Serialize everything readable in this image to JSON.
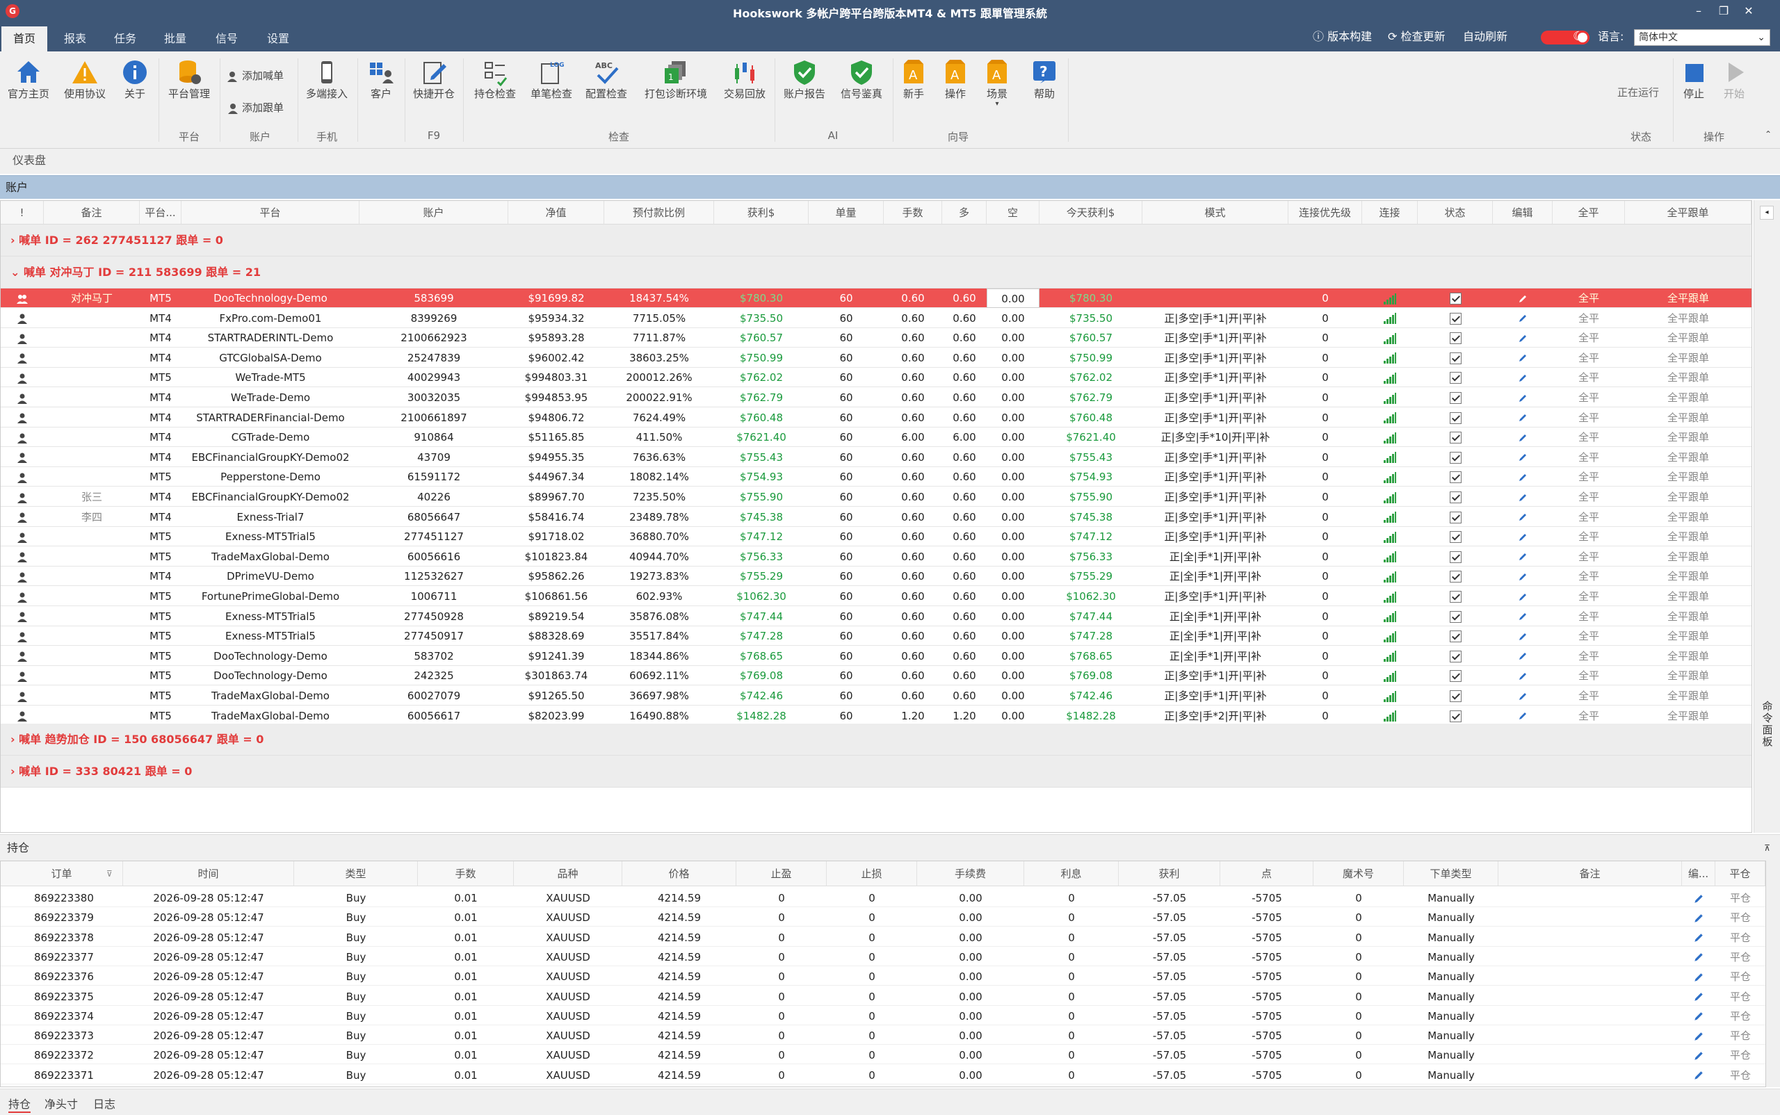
{
  "app": {
    "title": "Hookswork 多帐户跨平台跨版本MT4 & MT5 跟單管理系統",
    "logo": "G"
  },
  "menu": {
    "tabs": [
      "首页",
      "报表",
      "任务",
      "批量",
      "信号",
      "设置"
    ],
    "active": 0,
    "right": {
      "version": "版本构建",
      "update": "检查更新",
      "autorefresh": "自动刷新",
      "lang_label": "语言:",
      "lang_value": "简体中文"
    }
  },
  "ribbon": {
    "buttons": {
      "home": "官方主页",
      "agreement": "使用协议",
      "about": "关于",
      "platform_mgmt": "平台管理",
      "add_master": "添加喊单",
      "add_follower": "添加跟单",
      "mobile": "多端接入",
      "customer": "客户",
      "quick_open": "快捷开仓",
      "pos_check": "持仓检查",
      "order_check": "单笔检查",
      "config_check": "配置检查",
      "pack_diag": "打包诊断环境",
      "trade_replay": "交易回放",
      "account_report": "账户报告",
      "signal_eval": "信号鉴真",
      "novice": "新手",
      "operation": "操作",
      "scene": "场景",
      "help": "帮助",
      "stop": "停止",
      "start": "开始"
    },
    "groups": {
      "platform": "平台",
      "account": "账户",
      "mobile": "手机",
      "f9": "F9",
      "check": "检查",
      "ai": "AI",
      "guide": "向导",
      "status": "状态",
      "operate": "操作"
    },
    "status_text": "正在运行"
  },
  "dashboard_label": "仪表盘",
  "accounts_label": "账户",
  "columns": [
    "!",
    "备注",
    "平台...",
    "平台",
    "账户",
    "净值",
    "预付款比例",
    "获利$",
    "单量",
    "手数",
    "多",
    "空",
    "今天获利$",
    "模式",
    "连接优先级",
    "连接",
    "状态",
    "编辑",
    "全平",
    "全平跟单"
  ],
  "groups": {
    "g1": "›  喊单  ID = 262 277451127  跟单 = 0",
    "g2": "⌄  喊单  对冲马丁 ID = 211 583699  跟单 = 21",
    "g3": "›  喊单  趋势加仓 ID = 150 68056647  跟单 = 0",
    "g4": "›  喊单  ID = 333 80421  跟单 = 0"
  },
  "rows": [
    {
      "note": "对冲马丁",
      "pt": "MT5",
      "platform": "DooTechnology-Demo",
      "account": "583699",
      "equity": "$91699.82",
      "margin": "18437.54%",
      "profit": "$780.30",
      "orders": "60",
      "lots": "0.60",
      "long": "0.60",
      "short": "0.00",
      "today": "$780.30",
      "mode": "",
      "prio": "0",
      "full": "全平",
      "fullf": "全平跟单"
    },
    {
      "note": "",
      "pt": "MT4",
      "platform": "FxPro.com-Demo01",
      "account": "8399269",
      "equity": "$95934.32",
      "margin": "7715.05%",
      "profit": "$735.50",
      "orders": "60",
      "lots": "0.60",
      "long": "0.60",
      "short": "0.00",
      "today": "$735.50",
      "mode": "正|多空|手*1|开|平|补",
      "prio": "0",
      "full": "全平",
      "fullf": "全平跟单"
    },
    {
      "note": "",
      "pt": "MT4",
      "platform": "STARTRADERINTL-Demo",
      "account": "2100662923",
      "equity": "$95893.28",
      "margin": "7711.87%",
      "profit": "$760.57",
      "orders": "60",
      "lots": "0.60",
      "long": "0.60",
      "short": "0.00",
      "today": "$760.57",
      "mode": "正|多空|手*1|开|平|补",
      "prio": "0",
      "full": "全平",
      "fullf": "全平跟单"
    },
    {
      "note": "",
      "pt": "MT4",
      "platform": "GTCGlobalSA-Demo",
      "account": "25247839",
      "equity": "$96002.42",
      "margin": "38603.25%",
      "profit": "$750.99",
      "orders": "60",
      "lots": "0.60",
      "long": "0.60",
      "short": "0.00",
      "today": "$750.99",
      "mode": "正|多空|手*1|开|平|补",
      "prio": "0",
      "full": "全平",
      "fullf": "全平跟单"
    },
    {
      "note": "",
      "pt": "MT5",
      "platform": "WeTrade-MT5",
      "account": "40029943",
      "equity": "$994803.31",
      "margin": "200012.26%",
      "profit": "$762.02",
      "orders": "60",
      "lots": "0.60",
      "long": "0.60",
      "short": "0.00",
      "today": "$762.02",
      "mode": "正|多空|手*1|开|平|补",
      "prio": "0",
      "full": "全平",
      "fullf": "全平跟单"
    },
    {
      "note": "",
      "pt": "MT4",
      "platform": "WeTrade-Demo",
      "account": "30032035",
      "equity": "$994853.95",
      "margin": "200022.91%",
      "profit": "$762.79",
      "orders": "60",
      "lots": "0.60",
      "long": "0.60",
      "short": "0.00",
      "today": "$762.79",
      "mode": "正|多空|手*1|开|平|补",
      "prio": "0",
      "full": "全平",
      "fullf": "全平跟单"
    },
    {
      "note": "",
      "pt": "MT4",
      "platform": "STARTRADERFinancial-Demo",
      "account": "2100661897",
      "equity": "$94806.72",
      "margin": "7624.49%",
      "profit": "$760.48",
      "orders": "60",
      "lots": "0.60",
      "long": "0.60",
      "short": "0.00",
      "today": "$760.48",
      "mode": "正|多空|手*1|开|平|补",
      "prio": "0",
      "full": "全平",
      "fullf": "全平跟单"
    },
    {
      "note": "",
      "pt": "MT4",
      "platform": "CGTrade-Demo",
      "account": "910864",
      "equity": "$51165.85",
      "margin": "411.50%",
      "profit": "$7621.40",
      "orders": "60",
      "lots": "6.00",
      "long": "6.00",
      "short": "0.00",
      "today": "$7621.40",
      "mode": "正|多空|手*10|开|平|补",
      "prio": "0",
      "full": "全平",
      "fullf": "全平跟单"
    },
    {
      "note": "",
      "pt": "MT4",
      "platform": "EBCFinancialGroupKY-Demo02",
      "account": "43709",
      "equity": "$94955.35",
      "margin": "7636.63%",
      "profit": "$755.43",
      "orders": "60",
      "lots": "0.60",
      "long": "0.60",
      "short": "0.00",
      "today": "$755.43",
      "mode": "正|多空|手*1|开|平|补",
      "prio": "0",
      "full": "全平",
      "fullf": "全平跟单"
    },
    {
      "note": "",
      "pt": "MT5",
      "platform": "Pepperstone-Demo",
      "account": "61591172",
      "equity": "$44967.34",
      "margin": "18082.14%",
      "profit": "$754.93",
      "orders": "60",
      "lots": "0.60",
      "long": "0.60",
      "short": "0.00",
      "today": "$754.93",
      "mode": "正|多空|手*1|开|平|补",
      "prio": "0",
      "full": "全平",
      "fullf": "全平跟单"
    },
    {
      "note": "张三",
      "pt": "MT4",
      "platform": "EBCFinancialGroupKY-Demo02",
      "account": "40226",
      "equity": "$89967.70",
      "margin": "7235.50%",
      "profit": "$755.90",
      "orders": "60",
      "lots": "0.60",
      "long": "0.60",
      "short": "0.00",
      "today": "$755.90",
      "mode": "正|多空|手*1|开|平|补",
      "prio": "0",
      "full": "全平",
      "fullf": "全平跟单"
    },
    {
      "note": "李四",
      "pt": "MT4",
      "platform": "Exness-Trial7",
      "account": "68056647",
      "equity": "$58416.74",
      "margin": "23489.78%",
      "profit": "$745.38",
      "orders": "60",
      "lots": "0.60",
      "long": "0.60",
      "short": "0.00",
      "today": "$745.38",
      "mode": "正|多空|手*1|开|平|补",
      "prio": "0",
      "full": "全平",
      "fullf": "全平跟单"
    },
    {
      "note": "",
      "pt": "MT5",
      "platform": "Exness-MT5Trial5",
      "account": "277451127",
      "equity": "$91718.02",
      "margin": "36880.70%",
      "profit": "$747.12",
      "orders": "60",
      "lots": "0.60",
      "long": "0.60",
      "short": "0.00",
      "today": "$747.12",
      "mode": "正|多空|手*1|开|平|补",
      "prio": "0",
      "full": "全平",
      "fullf": "全平跟单"
    },
    {
      "note": "",
      "pt": "MT5",
      "platform": "TradeMaxGlobal-Demo",
      "account": "60056616",
      "equity": "$101823.84",
      "margin": "40944.70%",
      "profit": "$756.33",
      "orders": "60",
      "lots": "0.60",
      "long": "0.60",
      "short": "0.00",
      "today": "$756.33",
      "mode": "正|全|手*1|开|平|补",
      "prio": "0",
      "full": "全平",
      "fullf": "全平跟单"
    },
    {
      "note": "",
      "pt": "MT4",
      "platform": "DPrimeVU-Demo",
      "account": "112532627",
      "equity": "$95862.26",
      "margin": "19273.83%",
      "profit": "$755.29",
      "orders": "60",
      "lots": "0.60",
      "long": "0.60",
      "short": "0.00",
      "today": "$755.29",
      "mode": "正|全|手*1|开|平|补",
      "prio": "0",
      "full": "全平",
      "fullf": "全平跟单"
    },
    {
      "note": "",
      "pt": "MT5",
      "platform": "FortunePrimeGlobal-Demo",
      "account": "1006711",
      "equity": "$106861.56",
      "margin": "602.93%",
      "profit": "$1062.30",
      "orders": "60",
      "lots": "0.60",
      "long": "0.60",
      "short": "0.00",
      "today": "$1062.30",
      "mode": "正|多空|手*1|开|平|补",
      "prio": "0",
      "full": "全平",
      "fullf": "全平跟单"
    },
    {
      "note": "",
      "pt": "MT5",
      "platform": "Exness-MT5Trial5",
      "account": "277450928",
      "equity": "$89219.54",
      "margin": "35876.08%",
      "profit": "$747.44",
      "orders": "60",
      "lots": "0.60",
      "long": "0.60",
      "short": "0.00",
      "today": "$747.44",
      "mode": "正|全|手*1|开|平|补",
      "prio": "0",
      "full": "全平",
      "fullf": "全平跟单"
    },
    {
      "note": "",
      "pt": "MT5",
      "platform": "Exness-MT5Trial5",
      "account": "277450917",
      "equity": "$88328.69",
      "margin": "35517.84%",
      "profit": "$747.28",
      "orders": "60",
      "lots": "0.60",
      "long": "0.60",
      "short": "0.00",
      "today": "$747.28",
      "mode": "正|全|手*1|开|平|补",
      "prio": "0",
      "full": "全平",
      "fullf": "全平跟单"
    },
    {
      "note": "",
      "pt": "MT5",
      "platform": "DooTechnology-Demo",
      "account": "583702",
      "equity": "$91241.39",
      "margin": "18344.86%",
      "profit": "$768.65",
      "orders": "60",
      "lots": "0.60",
      "long": "0.60",
      "short": "0.00",
      "today": "$768.65",
      "mode": "正|全|手*1|开|平|补",
      "prio": "0",
      "full": "全平",
      "fullf": "全平跟单"
    },
    {
      "note": "",
      "pt": "MT5",
      "platform": "DooTechnology-Demo",
      "account": "242325",
      "equity": "$301863.74",
      "margin": "60692.11%",
      "profit": "$769.08",
      "orders": "60",
      "lots": "0.60",
      "long": "0.60",
      "short": "0.00",
      "today": "$769.08",
      "mode": "正|多空|手*1|开|平|补",
      "prio": "0",
      "full": "全平",
      "fullf": "全平跟单"
    },
    {
      "note": "",
      "pt": "MT5",
      "platform": "TradeMaxGlobal-Demo",
      "account": "60027079",
      "equity": "$91265.50",
      "margin": "36697.98%",
      "profit": "$742.46",
      "orders": "60",
      "lots": "0.60",
      "long": "0.60",
      "short": "0.00",
      "today": "$742.46",
      "mode": "正|多空|手*1|开|平|补",
      "prio": "0",
      "full": "全平",
      "fullf": "全平跟单"
    },
    {
      "note": "",
      "pt": "MT5",
      "platform": "TradeMaxGlobal-Demo",
      "account": "60056617",
      "equity": "$82023.99",
      "margin": "16490.88%",
      "profit": "$1482.28",
      "orders": "60",
      "lots": "1.20",
      "long": "1.20",
      "short": "0.00",
      "today": "$1482.28",
      "mode": "正|多空|手*2|开|平|补",
      "prio": "0",
      "full": "全平",
      "fullf": "全平跟单"
    }
  ],
  "command_panel": "命令面板",
  "positions": {
    "label": "持仓",
    "columns": [
      "订单",
      "时间",
      "类型",
      "手数",
      "品种",
      "价格",
      "止盈",
      "止损",
      "手续费",
      "利息",
      "获利",
      "点",
      "魔术号",
      "下单类型",
      "备注",
      "编...",
      "平仓"
    ],
    "rows": [
      {
        "order": "869223380",
        "time": "2026-09-28 05:12:47",
        "type": "Buy",
        "lots": "0.01",
        "symbol": "XAUUSD",
        "price": "4214.59",
        "tp": "0",
        "sl": "0",
        "fee": "0.00",
        "swap": "0",
        "profit": "-57.05",
        "points": "-5705",
        "magic": "0",
        "otype": "Manually",
        "note": "",
        "close": "平仓"
      },
      {
        "order": "869223379",
        "time": "2026-09-28 05:12:47",
        "type": "Buy",
        "lots": "0.01",
        "symbol": "XAUUSD",
        "price": "4214.59",
        "tp": "0",
        "sl": "0",
        "fee": "0.00",
        "swap": "0",
        "profit": "-57.05",
        "points": "-5705",
        "magic": "0",
        "otype": "Manually",
        "note": "",
        "close": "平仓"
      },
      {
        "order": "869223378",
        "time": "2026-09-28 05:12:47",
        "type": "Buy",
        "lots": "0.01",
        "symbol": "XAUUSD",
        "price": "4214.59",
        "tp": "0",
        "sl": "0",
        "fee": "0.00",
        "swap": "0",
        "profit": "-57.05",
        "points": "-5705",
        "magic": "0",
        "otype": "Manually",
        "note": "",
        "close": "平仓"
      },
      {
        "order": "869223377",
        "time": "2026-09-28 05:12:47",
        "type": "Buy",
        "lots": "0.01",
        "symbol": "XAUUSD",
        "price": "4214.59",
        "tp": "0",
        "sl": "0",
        "fee": "0.00",
        "swap": "0",
        "profit": "-57.05",
        "points": "-5705",
        "magic": "0",
        "otype": "Manually",
        "note": "",
        "close": "平仓"
      },
      {
        "order": "869223376",
        "time": "2026-09-28 05:12:47",
        "type": "Buy",
        "lots": "0.01",
        "symbol": "XAUUSD",
        "price": "4214.59",
        "tp": "0",
        "sl": "0",
        "fee": "0.00",
        "swap": "0",
        "profit": "-57.05",
        "points": "-5705",
        "magic": "0",
        "otype": "Manually",
        "note": "",
        "close": "平仓"
      },
      {
        "order": "869223375",
        "time": "2026-09-28 05:12:47",
        "type": "Buy",
        "lots": "0.01",
        "symbol": "XAUUSD",
        "price": "4214.59",
        "tp": "0",
        "sl": "0",
        "fee": "0.00",
        "swap": "0",
        "profit": "-57.05",
        "points": "-5705",
        "magic": "0",
        "otype": "Manually",
        "note": "",
        "close": "平仓"
      },
      {
        "order": "869223374",
        "time": "2026-09-28 05:12:47",
        "type": "Buy",
        "lots": "0.01",
        "symbol": "XAUUSD",
        "price": "4214.59",
        "tp": "0",
        "sl": "0",
        "fee": "0.00",
        "swap": "0",
        "profit": "-57.05",
        "points": "-5705",
        "magic": "0",
        "otype": "Manually",
        "note": "",
        "close": "平仓"
      },
      {
        "order": "869223373",
        "time": "2026-09-28 05:12:47",
        "type": "Buy",
        "lots": "0.01",
        "symbol": "XAUUSD",
        "price": "4214.59",
        "tp": "0",
        "sl": "0",
        "fee": "0.00",
        "swap": "0",
        "profit": "-57.05",
        "points": "-5705",
        "magic": "0",
        "otype": "Manually",
        "note": "",
        "close": "平仓"
      },
      {
        "order": "869223372",
        "time": "2026-09-28 05:12:47",
        "type": "Buy",
        "lots": "0.01",
        "symbol": "XAUUSD",
        "price": "4214.59",
        "tp": "0",
        "sl": "0",
        "fee": "0.00",
        "swap": "0",
        "profit": "-57.05",
        "points": "-5705",
        "magic": "0",
        "otype": "Manually",
        "note": "",
        "close": "平仓"
      },
      {
        "order": "869223371",
        "time": "2026-09-28 05:12:47",
        "type": "Buy",
        "lots": "0.01",
        "symbol": "XAUUSD",
        "price": "4214.59",
        "tp": "0",
        "sl": "0",
        "fee": "0.00",
        "swap": "0",
        "profit": "-57.05",
        "points": "-5705",
        "magic": "0",
        "otype": "Manually",
        "note": "",
        "close": "平仓"
      }
    ]
  },
  "bottom_tabs": [
    "持仓",
    "净头寸",
    "日志"
  ],
  "colors": {
    "titlebar": "#3e5777",
    "selected_row": "#ee5252",
    "group_text": "#e23b3b",
    "profit_green": "#1a9a3c",
    "accounts_header": "#adc4dc"
  }
}
